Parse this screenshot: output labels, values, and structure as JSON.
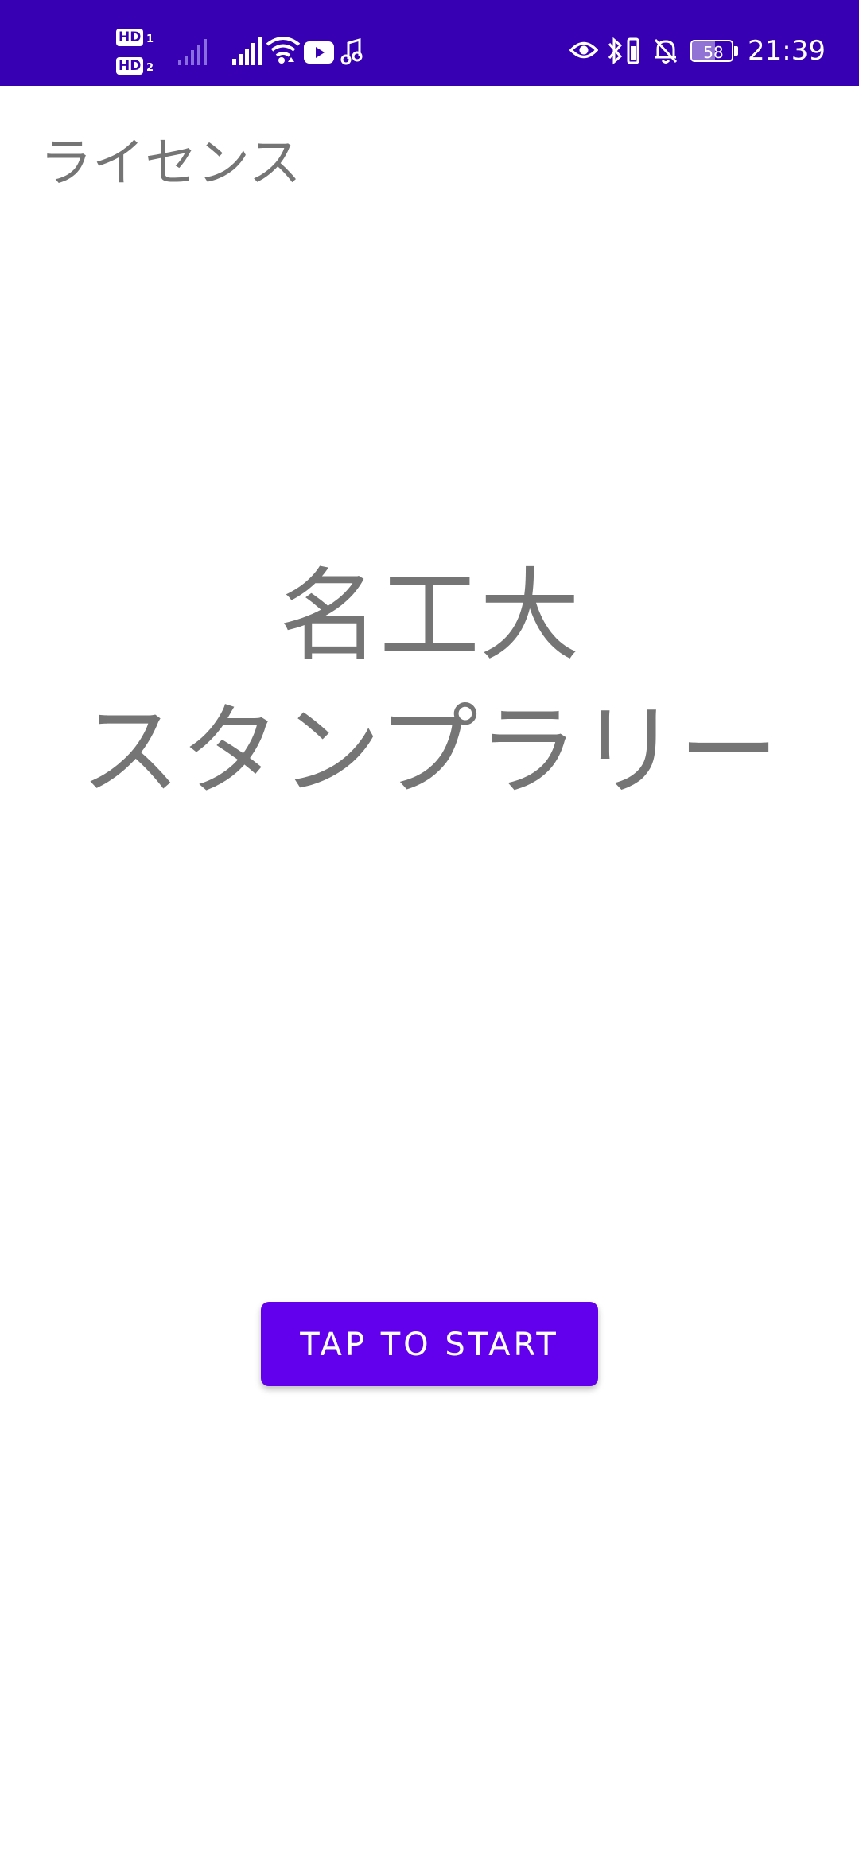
{
  "status_bar": {
    "background_color": "#3700b3",
    "sim1_label": "HD",
    "sim1_index": "1",
    "sim2_label": "HD",
    "sim2_index": "2",
    "battery_level": "58",
    "time": "21:39",
    "icons": [
      "hd-sim1-icon",
      "hd-sim2-icon",
      "signal-weak-icon",
      "signal-full-icon",
      "wifi-icon",
      "youtube-icon",
      "music-note-icon",
      "eye-icon",
      "bluetooth-icon",
      "vibrate-icon",
      "bell-off-icon",
      "battery-icon"
    ]
  },
  "license_link": "ライセンス",
  "title": {
    "line1": "名工大",
    "line2": "スタンプラリー"
  },
  "start_button": {
    "label": "TAP TO START",
    "color": "#6200ee"
  },
  "text_color": "#757575"
}
